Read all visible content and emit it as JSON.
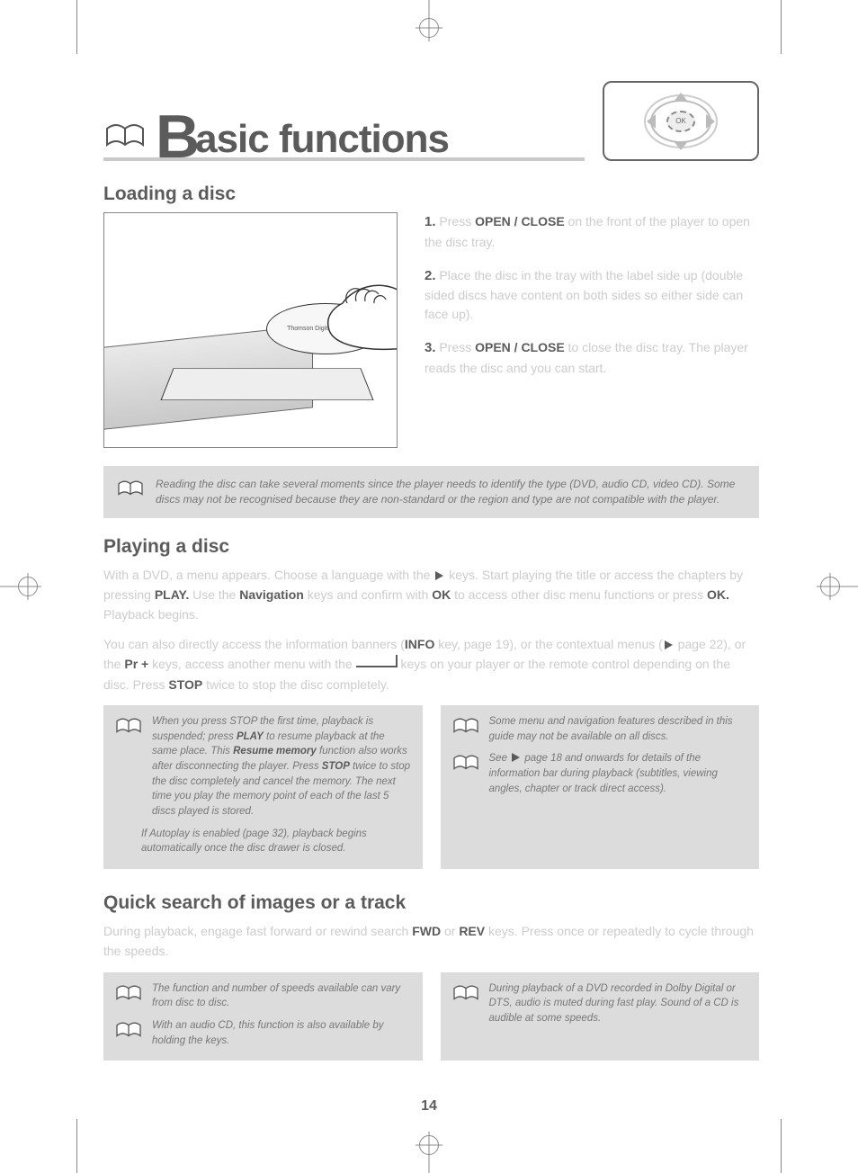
{
  "header": {
    "title_prefix_big": "B",
    "title_rest": "asic functions",
    "remote_center": "OK"
  },
  "section1": {
    "heading": "Loading a disc",
    "disc_label": "Thomson Digital Video Disc",
    "steps": {
      "s1_num": "1.",
      "s1_text_before": "Press ",
      "s1_kw": "OPEN / CLOSE",
      "s1_text_after": " on the front of the player to open the disc tray.",
      "s2_num": "2.",
      "s2_text": "Place the disc in the tray with the label side up (double sided discs have content on both sides so either side can face up).",
      "s3_num": "3.",
      "s3_text_before": "Press ",
      "s3_kw": "OPEN / CLOSE",
      "s3_text_after": " to close the disc tray. The player reads the disc and you can start."
    },
    "note": "Reading the disc can take several moments since the player needs to identify the type (DVD, audio CD, video CD). Some discs may not be recognised because they are non-standard or the region and type are not compatible with the player."
  },
  "section2": {
    "heading": "Playing a disc",
    "para1_parts": {
      "a": "With a DVD, a menu appears. Choose a language with the ",
      "arrow": true,
      "b": " keys. Start playing the title or access the chapters by pressing ",
      "kw_play": "PLAY.",
      "c": " Use the ",
      "kw_nav": "Navigation",
      "d": " keys and confirm with ",
      "kw_ok": "OK",
      "e": " to access other disc menu functions or press ",
      "kw_ok2": "OK.",
      "f": " Playback begins."
    },
    "para2_parts": {
      "a": "You can also directly access the information banners (",
      "kw_info": "INFO",
      "b": " key, page 19), or the contextual menus (",
      "arrow": true,
      "c": " page 22), or the ",
      "kw_pr": "Pr +",
      "d": " keys, access another menu with the ",
      "box": true,
      "e": " keys on your player or the remote control depending on the disc. Press ",
      "kw_stop": "STOP",
      "f": " twice to stop the disc completely."
    },
    "left_box": {
      "e1": "When you press STOP the first time, playback is suspended; press ",
      "kw_play": "PLAY",
      "e1b": " to resume playback at the same place. This ",
      "kw_resume": "Resume memory",
      "e1c": " function also works after disconnecting the player. Press ",
      "kw_stop": "STOP",
      "e1d": " twice to stop the disc completely and cancel the memory. The next time you play the memory point of each of the last 5 discs played is stored.",
      "e2": "If Autoplay is enabled (page 32), playback begins automatically once the disc drawer is closed."
    },
    "right_box": {
      "e1": "Some menu and navigation features described in this guide may not be available on all discs.",
      "e2_a": "See ",
      "e2_b": " page 18 and onwards for details of the information bar during playback (subtitles, viewing angles, chapter or track direct access)."
    }
  },
  "section3": {
    "heading": "Quick search of images or a track",
    "line_a": "During playback, engage fast forward or rewind search ",
    "kw_fwd": "FWD",
    "mid": " or ",
    "kw_rev": "REV",
    "line_b": " keys. Press once or repeatedly to cycle through the speeds.",
    "left_box": {
      "e1": "The function and number of speeds available can vary from disc to disc.",
      "e2": "With an audio CD, this function is also available by holding the keys."
    },
    "right_box": {
      "e1": "During playback of a DVD recorded in Dolby Digital or DTS, audio is muted during fast play. Sound of a CD is audible at some speeds."
    }
  },
  "page_number": "14"
}
